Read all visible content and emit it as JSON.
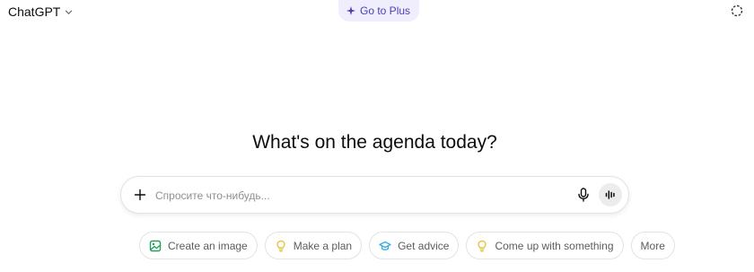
{
  "header": {
    "model_name": "ChatGPT",
    "upgrade_label": "Go to Plus"
  },
  "main": {
    "headline": "What's on the agenda today?"
  },
  "composer": {
    "placeholder": "Спросите что-нибудь..."
  },
  "suggestions": [
    {
      "label": "Create an image",
      "icon": "image-icon",
      "color": "#22a05a"
    },
    {
      "label": "Make a plan",
      "icon": "lightbulb-icon",
      "color": "#e2c541"
    },
    {
      "label": "Get advice",
      "icon": "graduation-cap-icon",
      "color": "#35aee0"
    },
    {
      "label": "Come up with something",
      "icon": "lightbulb-icon",
      "color": "#e2c541"
    },
    {
      "label": "More",
      "icon": "",
      "color": ""
    }
  ],
  "colors": {
    "accent": "#4a3fb5",
    "accent_bg": "#f0eefc"
  }
}
